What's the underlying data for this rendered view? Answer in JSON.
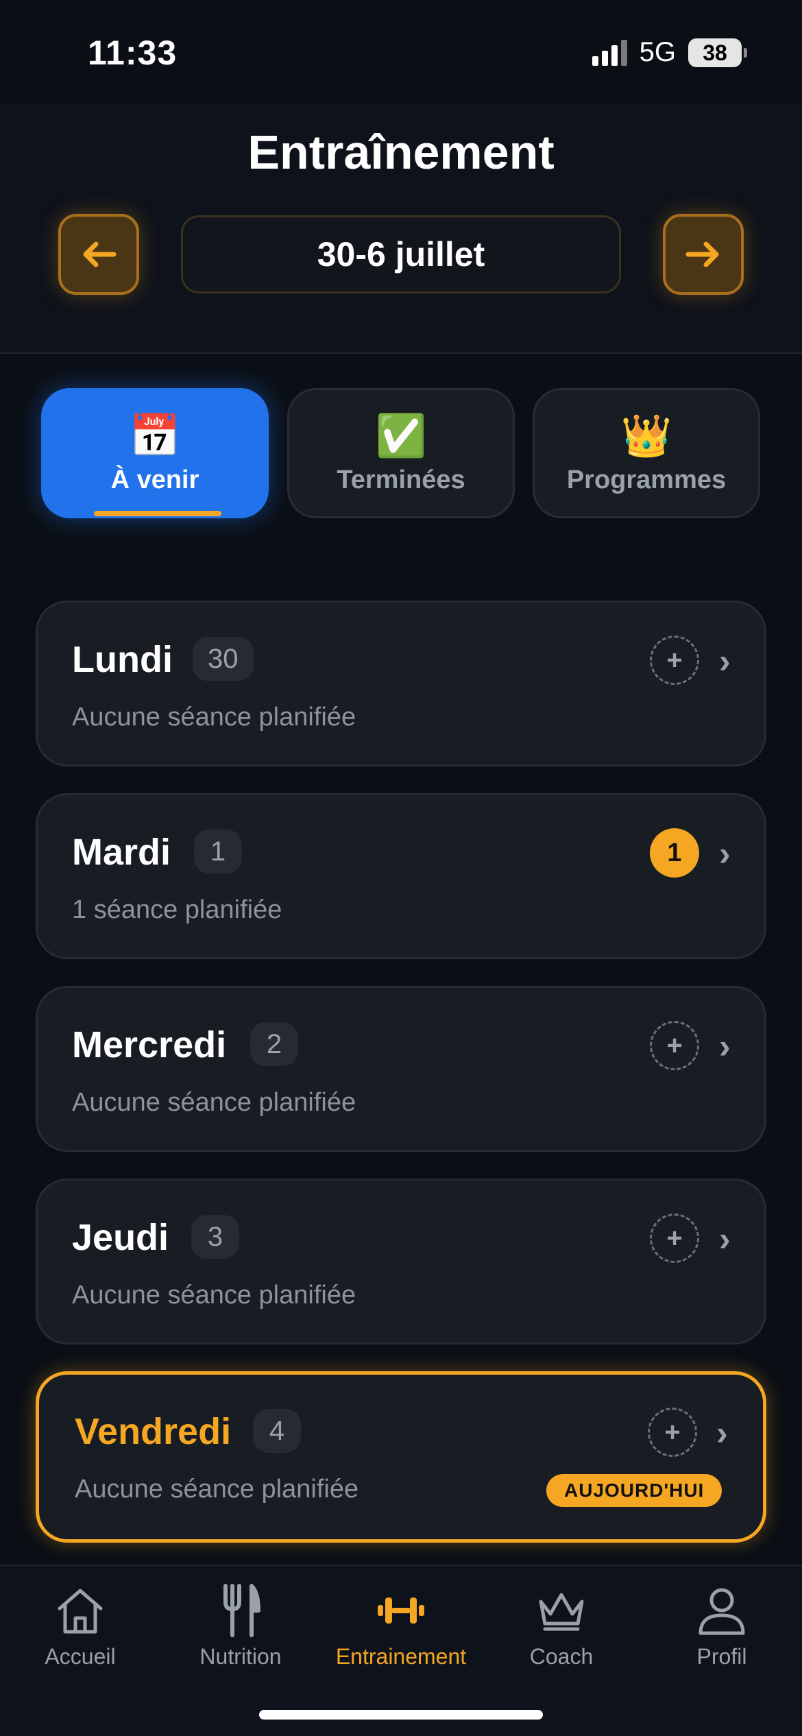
{
  "status_bar": {
    "time": "11:33",
    "network": "5G",
    "battery": "38"
  },
  "header": {
    "title": "Entraînement",
    "week_range": "30-6 juillet"
  },
  "tabs": [
    {
      "icon": "📅",
      "label": "À venir",
      "active": true
    },
    {
      "icon": "✅",
      "label": "Terminées",
      "active": false
    },
    {
      "icon": "👑",
      "label": "Programmes",
      "active": false
    }
  ],
  "days": [
    {
      "name": "Lundi",
      "date": "30",
      "subtitle": "Aucune séance planifiée",
      "sessions": null
    },
    {
      "name": "Mardi",
      "date": "1",
      "subtitle": "1 séance planifiée",
      "sessions": "1"
    },
    {
      "name": "Mercredi",
      "date": "2",
      "subtitle": "Aucune séance planifiée",
      "sessions": null
    },
    {
      "name": "Jeudi",
      "date": "3",
      "subtitle": "Aucune séance planifiée",
      "sessions": null
    },
    {
      "name": "Vendredi",
      "date": "4",
      "subtitle": "Aucune séance planifiée",
      "sessions": null,
      "today_label": "AUJOURD'HUI"
    }
  ],
  "nav": [
    {
      "label": "Accueil",
      "icon": "home-icon"
    },
    {
      "label": "Nutrition",
      "icon": "fork-knife-icon"
    },
    {
      "label": "Entrainement",
      "icon": "dumbbell-icon",
      "active": true
    },
    {
      "label": "Coach",
      "icon": "crown-icon"
    },
    {
      "label": "Profil",
      "icon": "person-icon"
    }
  ],
  "colors": {
    "accent": "#f5a623",
    "active_tab": "#2272ec",
    "background": "#0b0f15",
    "card": "#181c23"
  }
}
